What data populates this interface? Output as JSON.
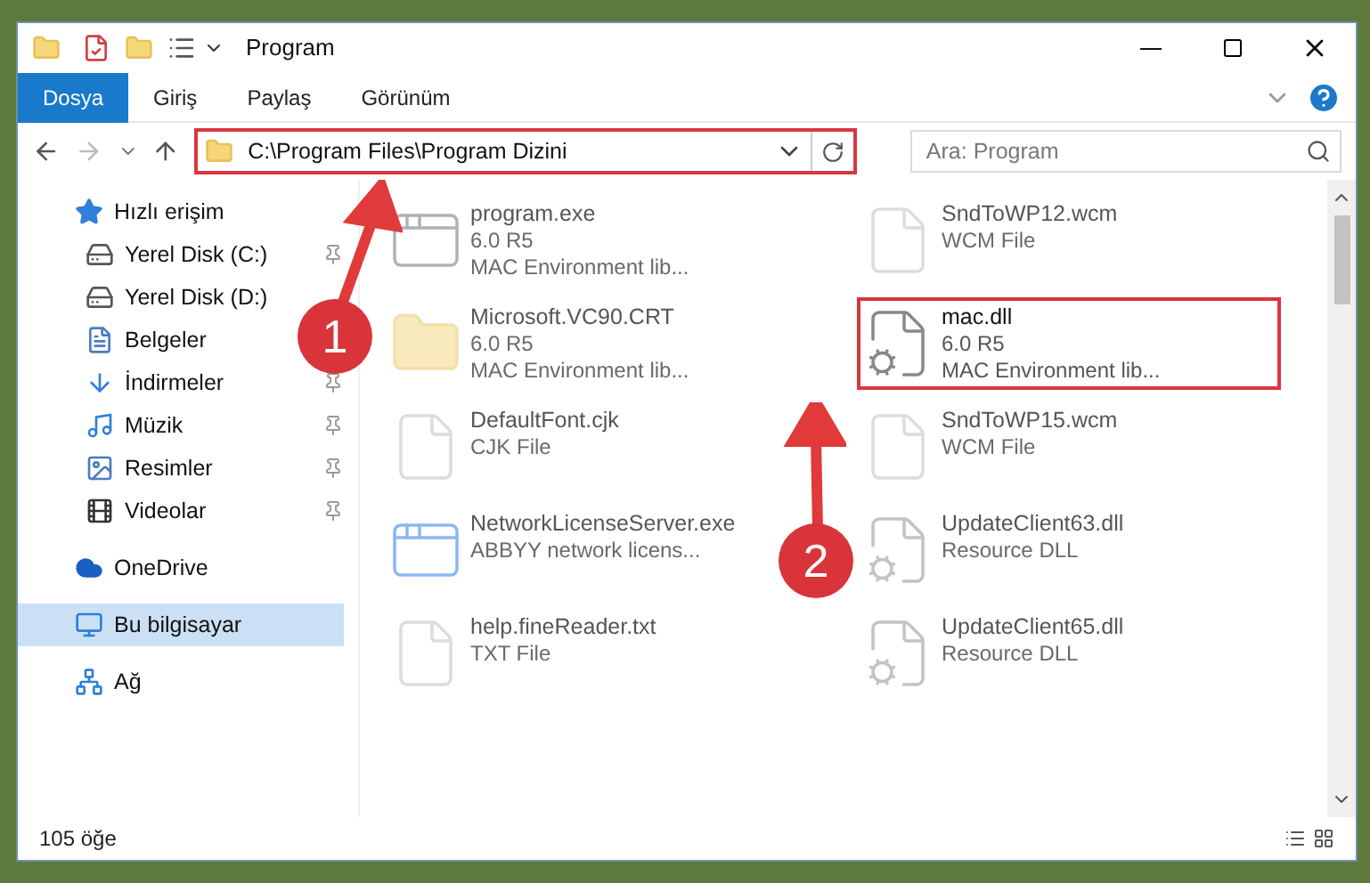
{
  "window": {
    "title": "Program"
  },
  "ribbon_tabs": [
    {
      "label": "Dosya",
      "selected": true
    },
    {
      "label": "Giriş",
      "selected": false
    },
    {
      "label": "Paylaş",
      "selected": false
    },
    {
      "label": "Görünüm",
      "selected": false
    }
  ],
  "address_bar": {
    "path": "C:\\Program Files\\Program Dizini",
    "highlighted": true
  },
  "search": {
    "placeholder": "Ara: Program"
  },
  "sidebar": {
    "items": [
      {
        "kind": "star",
        "label": "Hızlı erişim",
        "selected": false,
        "children": [
          {
            "kind": "disk",
            "label": "Yerel Disk (C:)",
            "selected": false,
            "pinned": true
          },
          {
            "kind": "disk",
            "label": "Yerel Disk (D:)",
            "selected": false,
            "pinned": false
          },
          {
            "kind": "docs",
            "label": "Belgeler",
            "selected": false,
            "pinned": false
          },
          {
            "kind": "download",
            "label": "İndirmeler",
            "selected": false,
            "pinned": true
          },
          {
            "kind": "music",
            "label": "Müzik",
            "selected": false,
            "pinned": true
          },
          {
            "kind": "pictures",
            "label": "Resimler",
            "selected": false,
            "pinned": true
          },
          {
            "kind": "video",
            "label": "Videolar",
            "selected": false,
            "pinned": true
          }
        ]
      },
      {
        "kind": "cloud",
        "label": "OneDrive",
        "selected": false
      },
      {
        "kind": "pc",
        "label": "Bu bilgisayar",
        "selected": true
      },
      {
        "kind": "network",
        "label": "Ağ",
        "selected": false
      }
    ]
  },
  "files": [
    {
      "kind": "exe",
      "name": "program.exe",
      "details": [
        "6.0 R5",
        "MAC Environment lib..."
      ],
      "blurred": true,
      "highlighted": false
    },
    {
      "kind": "file",
      "name": "SndToWP12.wcm",
      "details": [
        "WCM File"
      ],
      "blurred": true,
      "highlighted": false
    },
    {
      "kind": "folder",
      "name": "Microsoft.VC90.CRT",
      "details": [
        "6.0 R5",
        "MAC Environment lib..."
      ],
      "blurred": true,
      "highlighted": false
    },
    {
      "kind": "dll",
      "name": "mac.dll",
      "details": [
        "6.0 R5",
        "MAC Environment lib..."
      ],
      "blurred": false,
      "highlighted": true
    },
    {
      "kind": "file",
      "name": "DefaultFont.cjk",
      "details": [
        "CJK File"
      ],
      "blurred": true,
      "highlighted": false
    },
    {
      "kind": "file",
      "name": "SndToWP15.wcm",
      "details": [
        "WCM File"
      ],
      "blurred": true,
      "highlighted": false
    },
    {
      "kind": "app",
      "name": "NetworkLicenseServer.exe",
      "details": [
        "ABBYY network licens..."
      ],
      "blurred": true,
      "highlighted": false
    },
    {
      "kind": "dll",
      "name": "UpdateClient63.dll",
      "details": [
        "Resource DLL"
      ],
      "blurred": true,
      "highlighted": false
    },
    {
      "kind": "file",
      "name": "help.fineReader.txt",
      "details": [
        "TXT File"
      ],
      "blurred": true,
      "highlighted": false
    },
    {
      "kind": "dll",
      "name": "UpdateClient65.dll",
      "details": [
        "Resource DLL"
      ],
      "blurred": true,
      "highlighted": false
    }
  ],
  "status_bar": {
    "count": "105 öğe"
  },
  "annotations": [
    {
      "label": "1"
    },
    {
      "label": "2"
    }
  ]
}
